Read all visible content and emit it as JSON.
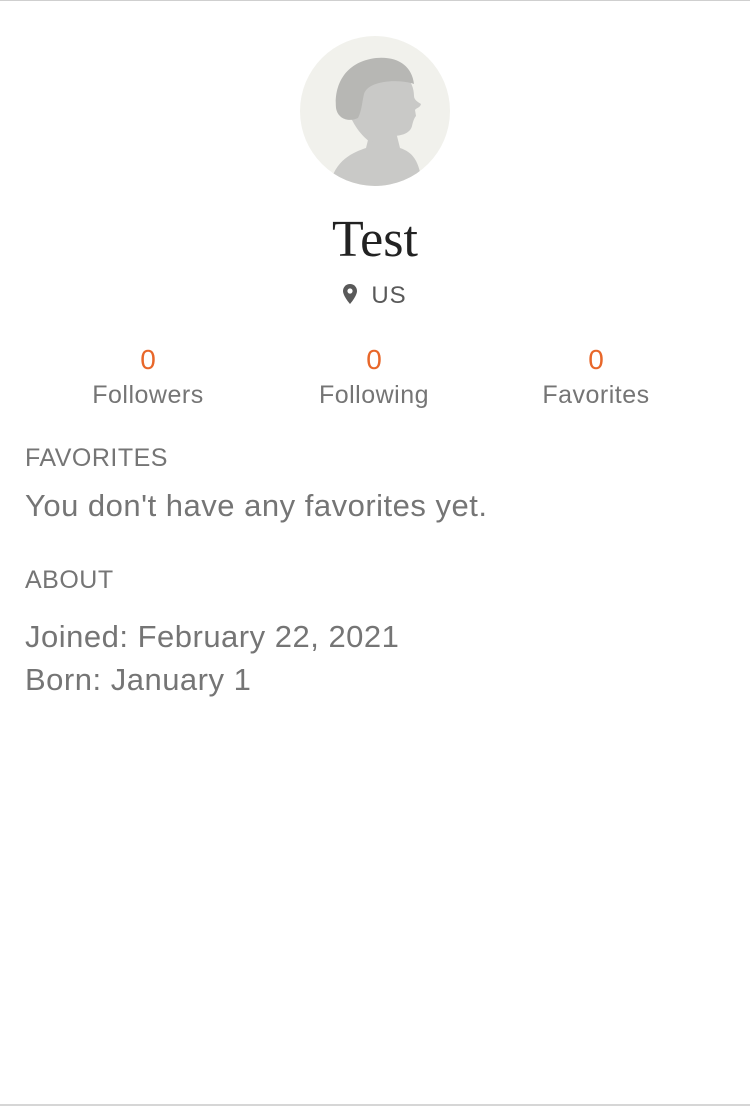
{
  "profile": {
    "avatar_icon": "default-avatar-silhouette-icon",
    "name": "Test",
    "location": "US",
    "location_icon": "map-pin-icon"
  },
  "stats": [
    {
      "count": "0",
      "label": "Followers"
    },
    {
      "count": "0",
      "label": "Following"
    },
    {
      "count": "0",
      "label": "Favorites"
    }
  ],
  "favorites_section": {
    "heading": "FAVORITES",
    "empty_message": "You don't have any favorites yet."
  },
  "about_section": {
    "heading": "ABOUT",
    "joined": "Joined: February 22, 2021",
    "born": "Born: January 1"
  },
  "colors": {
    "accent": "#e8672a",
    "text_primary": "#222222",
    "text_secondary": "#757575",
    "avatar_bg": "#f1f1ec"
  }
}
